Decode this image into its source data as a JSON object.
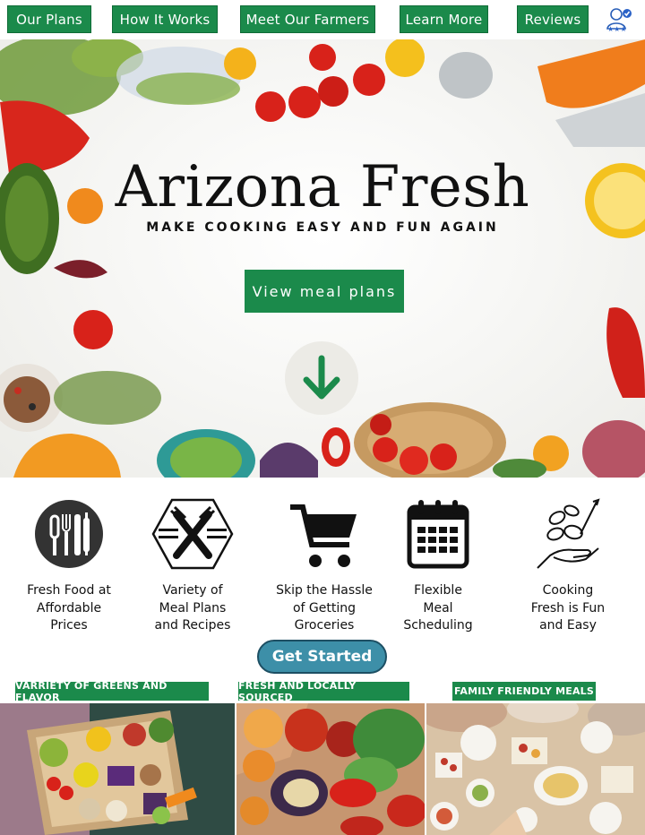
{
  "nav": {
    "items": [
      {
        "label": "Our Plans"
      },
      {
        "label": "How It Works"
      },
      {
        "label": "Meet Our Farmers"
      },
      {
        "label": "Learn More"
      },
      {
        "label": "Reviews"
      }
    ],
    "user_icon": "verified-user-rating-icon"
  },
  "hero": {
    "title": "Arizona Fresh",
    "subtitle": "MAKE COOKING EASY AND FUN AGAIN",
    "cta_label": "View meal plans",
    "scroll_icon": "arrow-down-icon"
  },
  "features": [
    {
      "icon": "kitchen-utensils-icon",
      "label": "Fresh Food at\nAffordable\nPrices"
    },
    {
      "icon": "crossed-forks-icon",
      "label": "Variety of\nMeal Plans\nand Recipes"
    },
    {
      "icon": "shopping-cart-icon",
      "label": "Skip the Hassle\nof Getting\nGroceries"
    },
    {
      "icon": "calendar-icon",
      "label": "Flexible\nMeal\nScheduling"
    },
    {
      "icon": "hand-with-vegetables-icon",
      "label": "Cooking\nFresh is Fun\nand Easy"
    }
  ],
  "get_started_label": "Get Started",
  "highlights": [
    {
      "label": "VARRIETY OF GREENS AND FLAVOR",
      "image": "grocery-box-photo"
    },
    {
      "label": "FRESH AND LOCALLY SOURCED",
      "image": "fresh-produce-photo"
    },
    {
      "label": "FAMILY FRIENDLY MEALS",
      "image": "family-dinner-table-photo"
    }
  ],
  "colors": {
    "brand_green": "#1b8a4b",
    "get_started_blue": "#3d8fa8"
  }
}
